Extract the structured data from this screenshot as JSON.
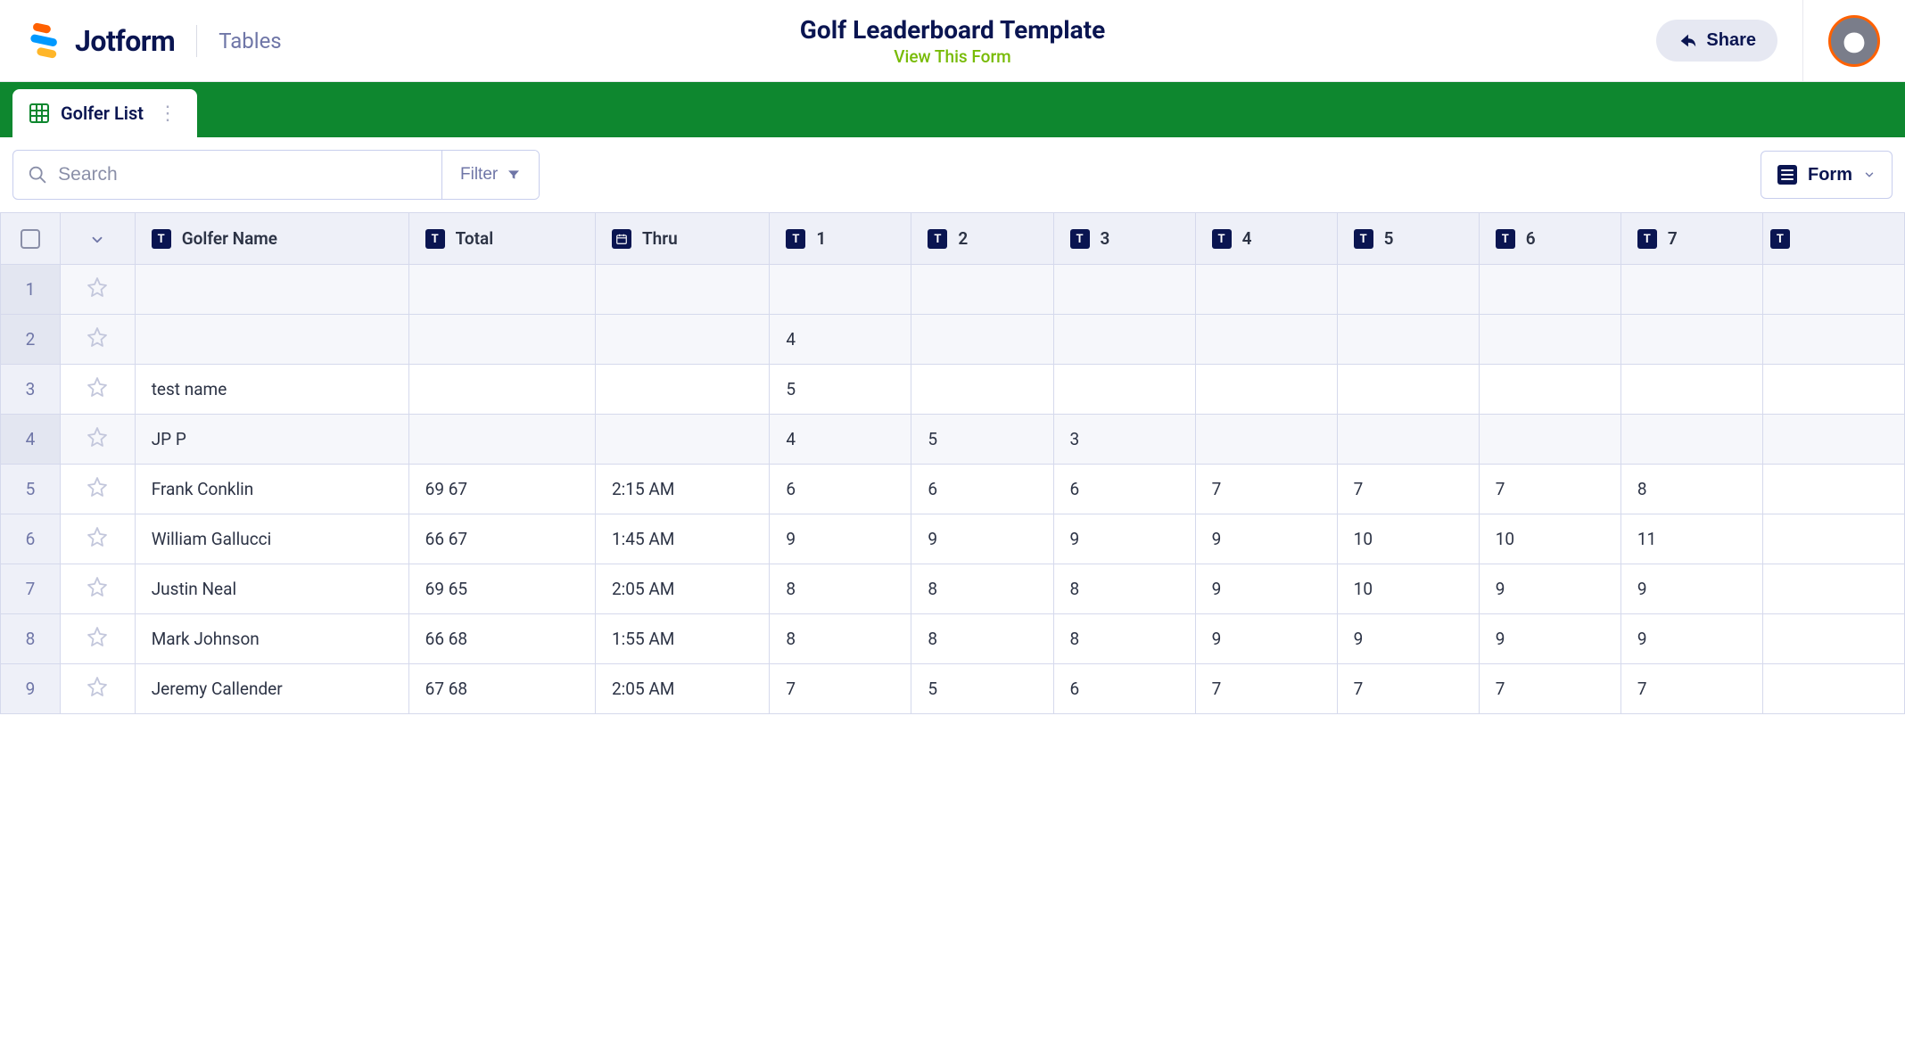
{
  "header": {
    "brand": "Jotform",
    "section": "Tables",
    "title": "Golf Leaderboard Template",
    "view_link": "View This Form",
    "share_label": "Share"
  },
  "tab": {
    "label": "Golfer List"
  },
  "toolbar": {
    "search_placeholder": "Search",
    "filter_label": "Filter",
    "form_label": "Form"
  },
  "columns": {
    "name": "Golfer Name",
    "total": "Total",
    "thru": "Thru",
    "h1": "1",
    "h2": "2",
    "h3": "3",
    "h4": "4",
    "h5": "5",
    "h6": "6",
    "h7": "7"
  },
  "rows": [
    {
      "n": "1",
      "name": "",
      "total": "",
      "thru": "",
      "h1": "",
      "h2": "",
      "h3": "",
      "h4": "",
      "h5": "",
      "h6": "",
      "h7": "",
      "shaded": true
    },
    {
      "n": "2",
      "name": "",
      "total": "",
      "thru": "",
      "h1": "4",
      "h2": "",
      "h3": "",
      "h4": "",
      "h5": "",
      "h6": "",
      "h7": "",
      "shaded": true
    },
    {
      "n": "3",
      "name": "test name",
      "total": "",
      "thru": "",
      "h1": "5",
      "h2": "",
      "h3": "",
      "h4": "",
      "h5": "",
      "h6": "",
      "h7": "",
      "shaded": false
    },
    {
      "n": "4",
      "name": "JP P",
      "total": "",
      "thru": "",
      "h1": "4",
      "h2": "5",
      "h3": "3",
      "h4": "",
      "h5": "",
      "h6": "",
      "h7": "",
      "shaded": true
    },
    {
      "n": "5",
      "name": "Frank Conklin",
      "total": "69 67",
      "thru": "2:15 AM",
      "h1": "6",
      "h2": "6",
      "h3": "6",
      "h4": "7",
      "h5": "7",
      "h6": "7",
      "h7": "8",
      "shaded": false
    },
    {
      "n": "6",
      "name": "William Gallucci",
      "total": "66 67",
      "thru": "1:45 AM",
      "h1": "9",
      "h2": "9",
      "h3": "9",
      "h4": "9",
      "h5": "10",
      "h6": "10",
      "h7": "11",
      "shaded": false
    },
    {
      "n": "7",
      "name": "Justin Neal",
      "total": "69 65",
      "thru": "2:05 AM",
      "h1": "8",
      "h2": "8",
      "h3": "8",
      "h4": "9",
      "h5": "10",
      "h6": "9",
      "h7": "9",
      "shaded": false
    },
    {
      "n": "8",
      "name": "Mark Johnson",
      "total": "66 68",
      "thru": "1:55 AM",
      "h1": "8",
      "h2": "8",
      "h3": "8",
      "h4": "9",
      "h5": "9",
      "h6": "9",
      "h7": "9",
      "shaded": false
    },
    {
      "n": "9",
      "name": "Jeremy Callender",
      "total": "67 68",
      "thru": "2:05 AM",
      "h1": "7",
      "h2": "5",
      "h3": "6",
      "h4": "7",
      "h5": "7",
      "h6": "7",
      "h7": "7",
      "shaded": false
    }
  ]
}
